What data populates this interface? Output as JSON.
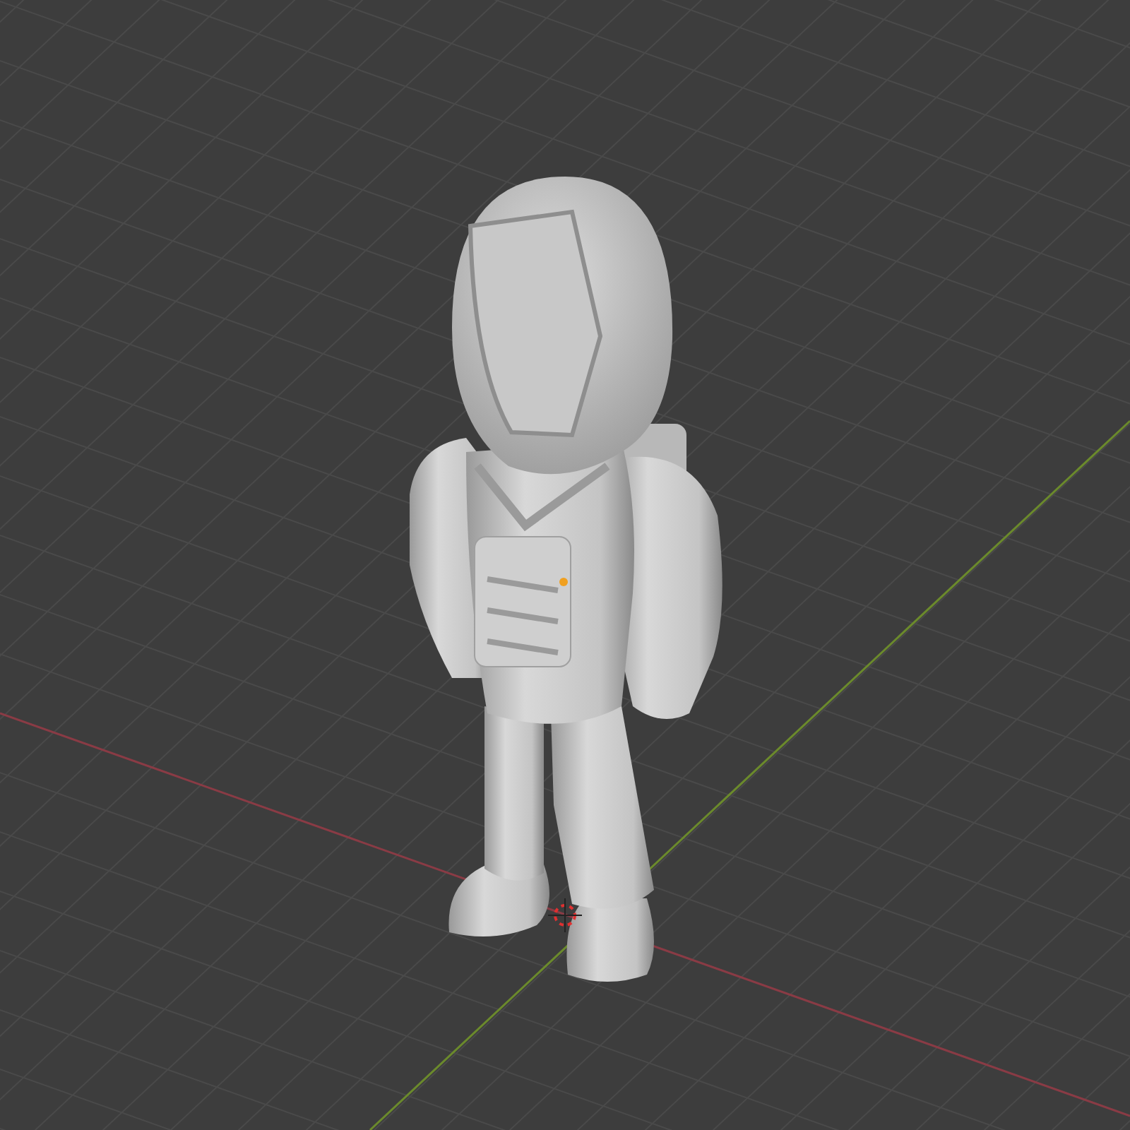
{
  "viewport": {
    "grid": true,
    "x_axis": true,
    "y_axis": true,
    "cursor_3d": true,
    "origin_dot": true
  }
}
